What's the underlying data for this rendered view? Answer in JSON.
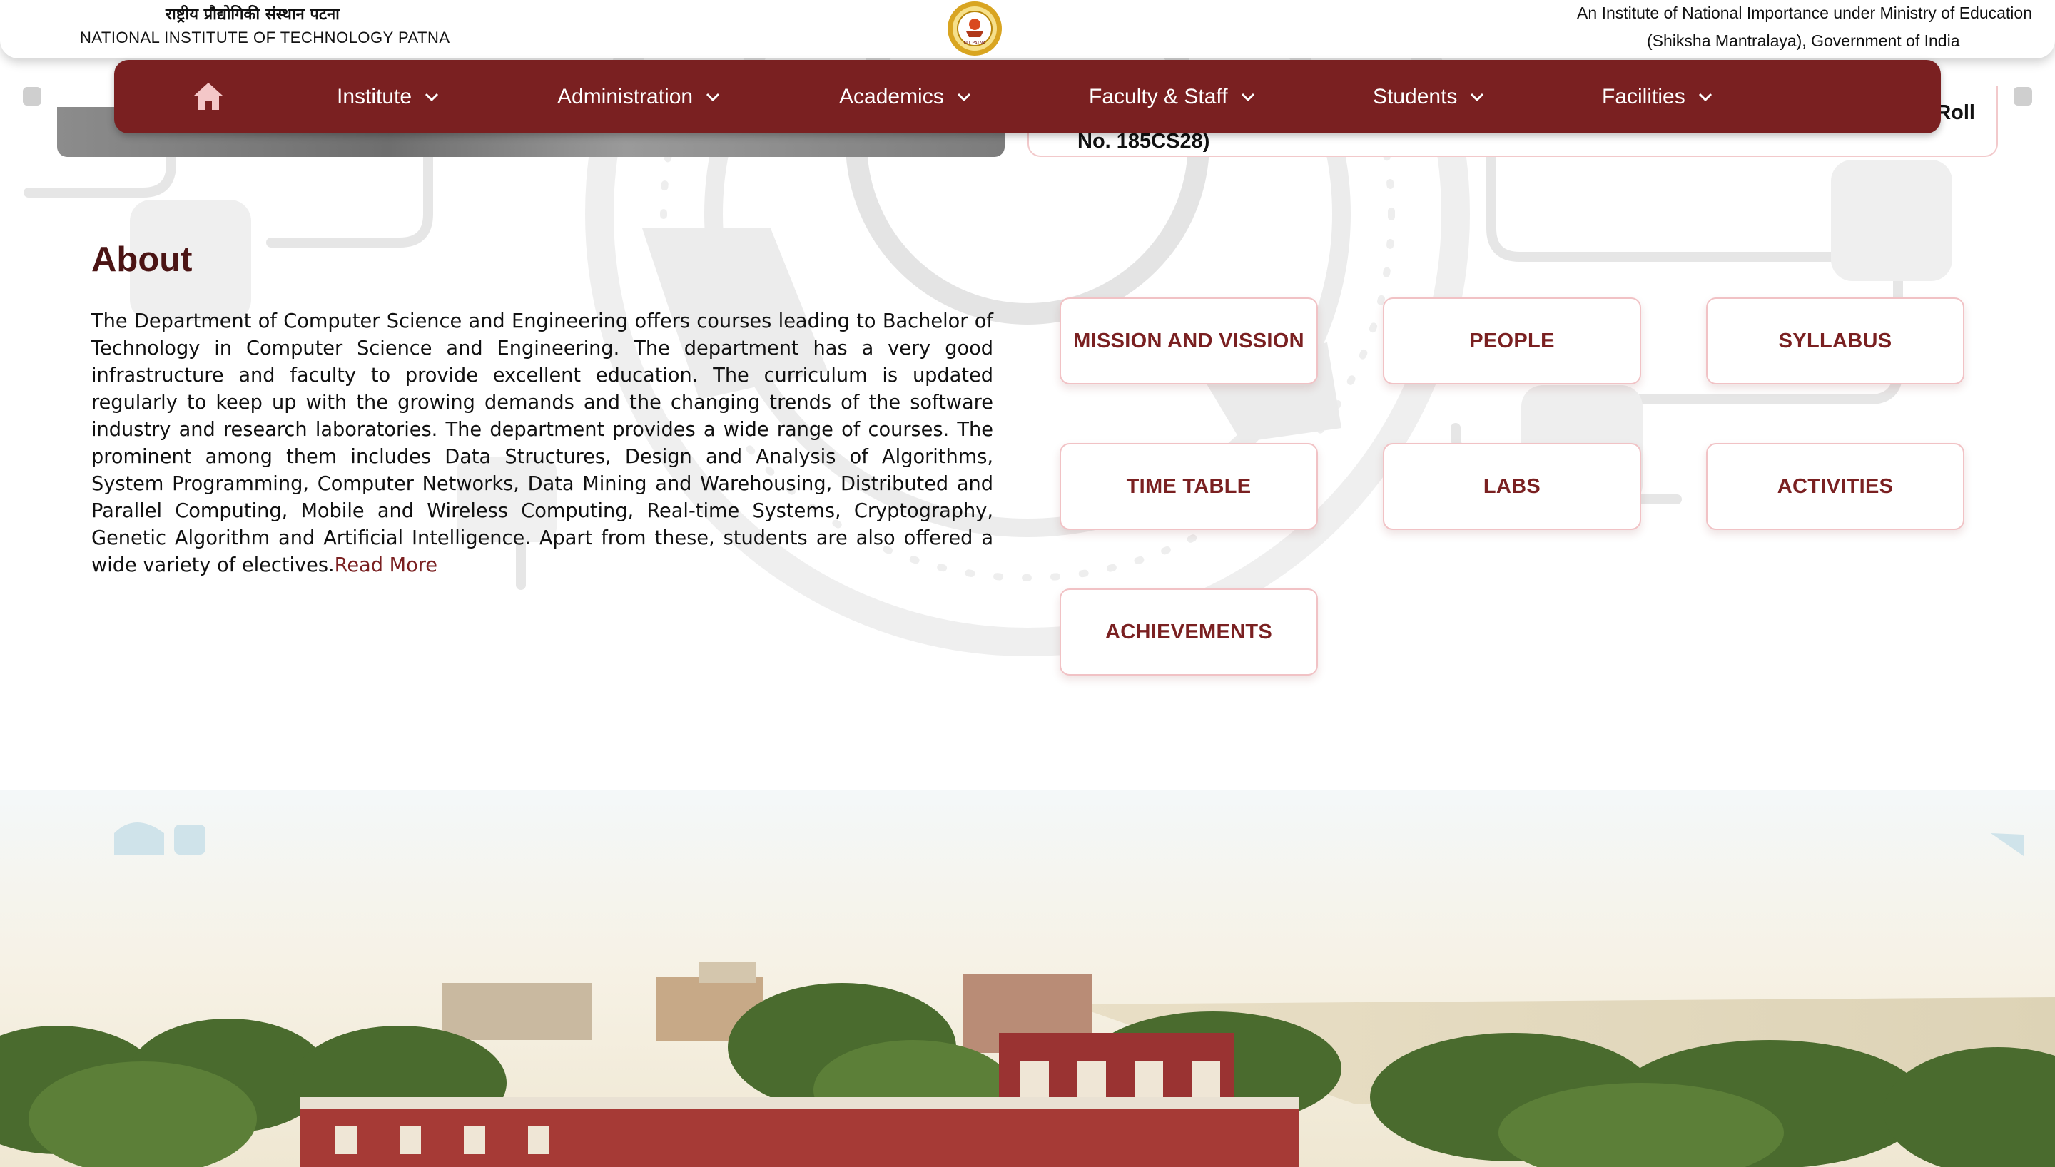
{
  "header": {
    "institute_name_hindi": "राष्ट्रीय प्रौद्योगिकी संस्थान पटना",
    "institute_name_english": "NATIONAL INSTITUTE OF TECHNOLOGY PATNA",
    "logo_text": "NIT PATNA",
    "tagline_line1": "An Institute of National Importance under Ministry of Education",
    "tagline_line2": "(Shiksha Mantralaya), Government of India"
  },
  "nav": {
    "items": [
      {
        "label": "Institute"
      },
      {
        "label": "Administration"
      },
      {
        "label": "Academics"
      },
      {
        "label": "Faculty & Staff"
      },
      {
        "label": "Students"
      },
      {
        "label": "Facilities"
      }
    ]
  },
  "news": {
    "text_end": "Roll",
    "text_line2": "No. 185CS28)"
  },
  "about": {
    "title": "About",
    "body": "The Department of Computer Science and Engineering offers courses leading to Bachelor of Technology in Computer Science and Engineering. The department has a very good infrastructure and faculty to provide excellent education. The curriculum is updated regularly to keep up with the growing demands and the changing trends of the software industry and research laboratories. The department provides a wide range of courses. The prominent among them includes Data Structures, Design and Analysis of Algorithms, System Programming, Computer Networks, Data Mining and Warehousing, Distributed and Parallel Computing, Mobile and Wireless Computing, Real-time Systems, Cryptography, Genetic Algorithm and Artificial Intelligence. Apart from these, students are also offered a wide variety of electives.",
    "read_more": "Read More"
  },
  "quick_links": [
    {
      "label": "MISSION AND VISSION"
    },
    {
      "label": "PEOPLE"
    },
    {
      "label": "SYLLABUS"
    },
    {
      "label": "TIME TABLE"
    },
    {
      "label": "LABS"
    },
    {
      "label": "ACTIVITIES"
    },
    {
      "label": "ACHIEVEMENTS"
    }
  ],
  "colors": {
    "brand_maroon": "#7a2021",
    "card_border": "#f1c2c5",
    "about_title": "#4b1414"
  }
}
